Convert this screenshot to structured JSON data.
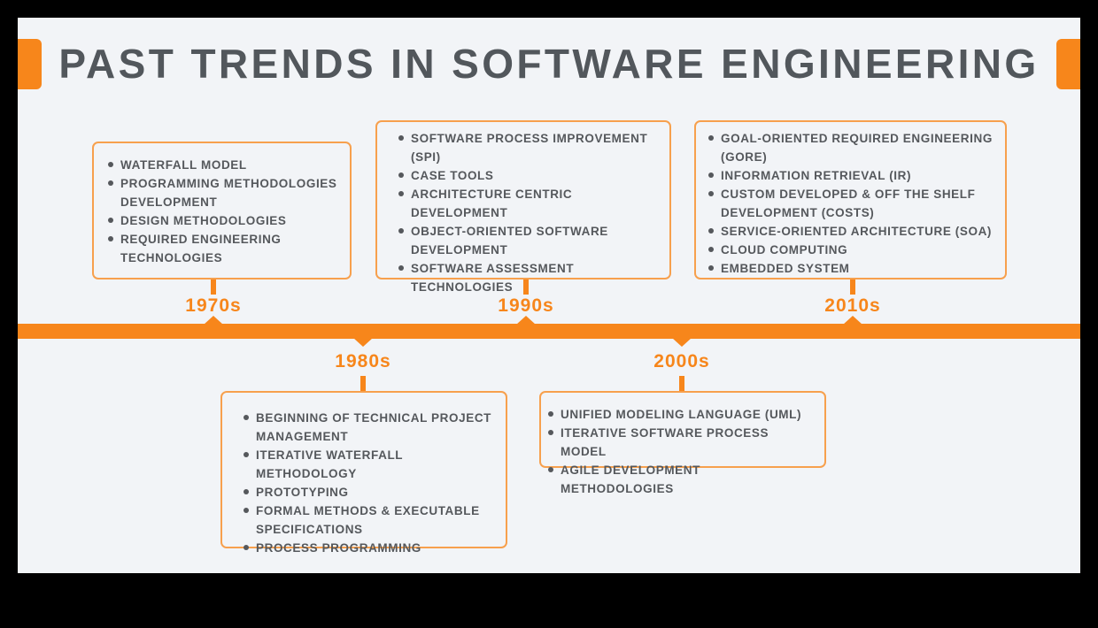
{
  "title": "PAST TRENDS IN SOFTWARE ENGINEERING",
  "colors": {
    "accent": "#f7861b",
    "text": "#52575c",
    "background": "#f2f4f7"
  },
  "eras": [
    {
      "label": "1970s",
      "items": [
        "WATERFALL MODEL",
        "PROGRAMMING METHODOLOGIES DEVELOPMENT",
        "DESIGN METHODOLOGIES",
        "REQUIRED ENGINEERING TECHNOLOGIES"
      ]
    },
    {
      "label": "1980s",
      "items": [
        "BEGINNING OF TECHNICAL PROJECT MANAGEMENT",
        "ITERATIVE WATERFALL METHODOLOGY",
        "PROTOTYPING",
        "FORMAL METHODS & EXECUTABLE SPECIFICATIONS",
        "PROCESS PROGRAMMING"
      ]
    },
    {
      "label": "1990s",
      "items": [
        "SOFTWARE PROCESS IMPROVEMENT (SPI)",
        "CASE TOOLS",
        "ARCHITECTURE CENTRIC DEVELOPMENT",
        "OBJECT-ORIENTED SOFTWARE DEVELOPMENT",
        "SOFTWARE ASSESSMENT TECHNOLOGIES"
      ]
    },
    {
      "label": "2000s",
      "items": [
        "UNIFIED MODELING LANGUAGE (UML)",
        "ITERATIVE SOFTWARE PROCESS MODEL",
        "AGILE DEVELOPMENT METHODOLOGIES"
      ]
    },
    {
      "label": "2010s",
      "items": [
        "GOAL-ORIENTED REQUIRED ENGINEERING (GORE)",
        "INFORMATION RETRIEVAL (IR)",
        "CUSTOM DEVELOPED & OFF THE SHELF DEVELOPMENT (COSTS)",
        "SERVICE-ORIENTED ARCHITECTURE (SOA)",
        "CLOUD COMPUTING",
        "EMBEDDED SYSTEM"
      ]
    }
  ]
}
